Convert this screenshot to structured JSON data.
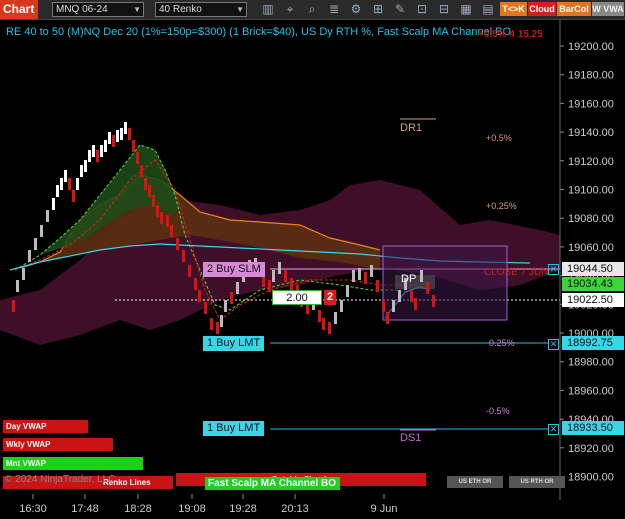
{
  "toolbar": {
    "app_title": "Chart",
    "instrument": "MNQ 06-24",
    "bar_type": "40 Renko",
    "btn_tk": "T<>K",
    "btn_cloud": "Cloud",
    "btn_barcol": "BarCol",
    "btn_wvwa": "W VWA",
    "colors": {
      "tk": "#e8741a",
      "cloud": "#d61e1e",
      "barcol": "#e8741a",
      "wvwa": "#888888"
    }
  },
  "header": {
    "title": "RE 40 to 50 (M)NQ Dec 20 (1%=150p=$300) (1 Brick=$40), US Dy RTH %, Fast Scalp MA Channel BO",
    "top_pct": "+0.5% 4 15.25"
  },
  "levels": {
    "dr1": "DR1",
    "ds1": "DS1",
    "pct_05": "+0.5%",
    "pct_025": "+0.25%",
    "pct_m025": "0.25%",
    "pct_m05": "-0.5%",
    "close_label": "CLOSE 7 JUN",
    "dp_label": "DP"
  },
  "orders": {
    "buy_slm": "2 Buy SLM",
    "buy_lmt_1": "1 Buy LMT",
    "buy_lmt_2": "1 Buy LMT",
    "qty_value": "2.00",
    "qty_badge": "2"
  },
  "price_tags": {
    "p1": "19044.50",
    "p2": "19034.43",
    "p3": "19022.50",
    "p4": "18992.75",
    "p5": "18933.50"
  },
  "chart_data": {
    "type": "table",
    "y_axis": {
      "labels": [
        "19200.00",
        "19180.00",
        "19160.00",
        "19140.00",
        "19120.00",
        "19100.00",
        "19080.00",
        "19060.00",
        "19040.00",
        "19020.00",
        "19000.00",
        "18980.00",
        "18960.00",
        "18940.00",
        "18920.00",
        "18900.00"
      ],
      "min": 18886,
      "max": 19212
    },
    "x_axis": {
      "labels": [
        "16:30",
        "17:48",
        "18:28",
        "19:08",
        "19:28",
        "20:13",
        "9 Jun"
      ]
    }
  },
  "bottom_labels": {
    "day_vwap": "Day VWAP",
    "wkly_vwap": "Wkly VWAP",
    "mnt_vwap": "Mnt VWAP",
    "renko_lines": "Renko Lines",
    "outside_clouds": "Outside Clouds",
    "fast_scalp": "Fast Scalp MA Channel BO",
    "us_eth": "US ETH OR",
    "us_rth": "US RTH OR",
    "copyright": "© 2024 NinjaTrader, LLC"
  }
}
